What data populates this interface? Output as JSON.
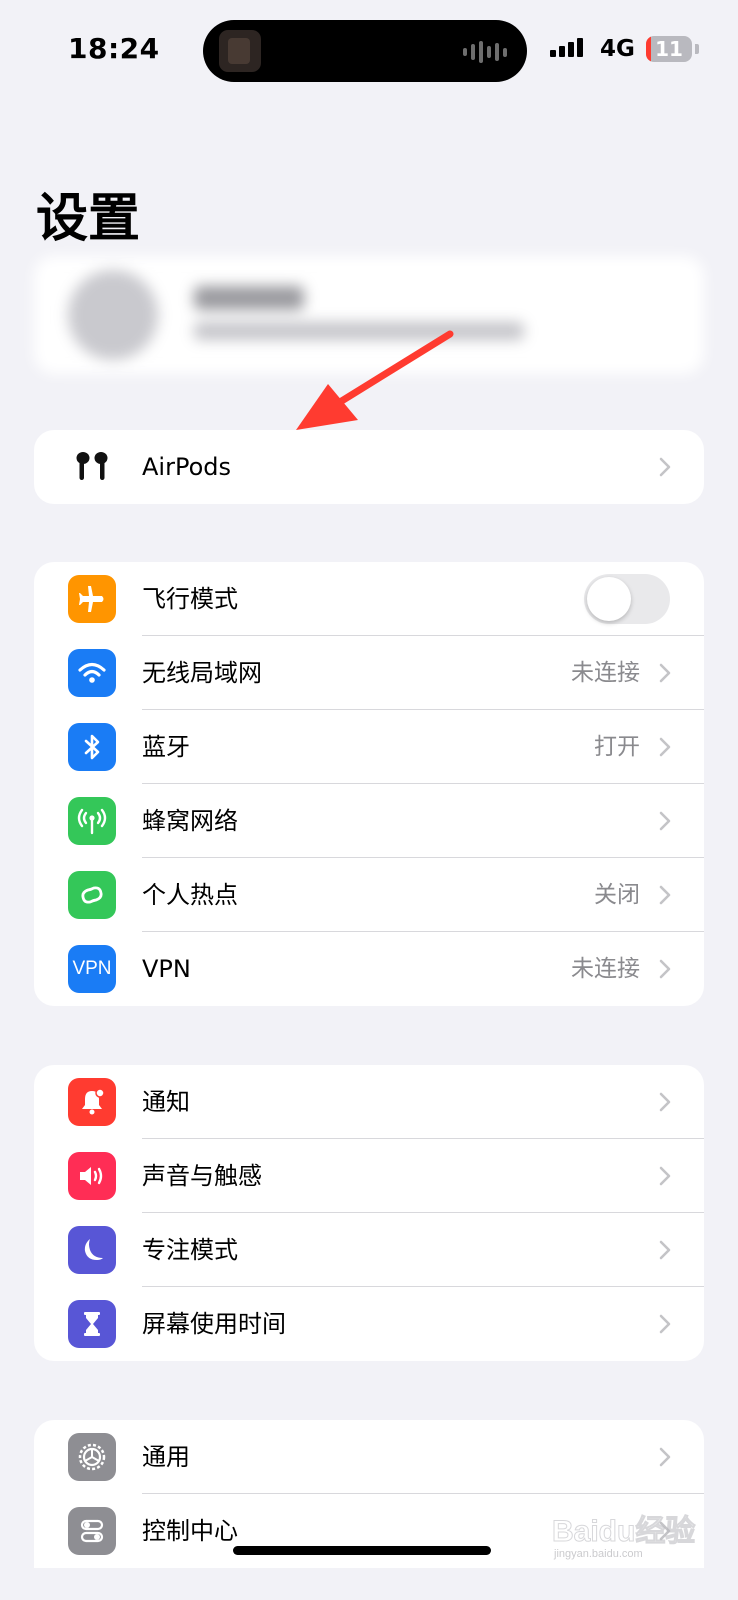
{
  "status_bar": {
    "time": "18:24",
    "network": "4G",
    "battery": "11"
  },
  "page": {
    "title": "设置"
  },
  "airpods_group": {
    "label": "AirPods"
  },
  "connectivity": [
    {
      "label": "飞行模式",
      "icon": "airplane-icon",
      "color": "#ff9500",
      "toggle": false
    },
    {
      "label": "无线局域网",
      "value": "未连接",
      "icon": "wifi-icon",
      "color": "#1a7cf5"
    },
    {
      "label": "蓝牙",
      "value": "打开",
      "icon": "bluetooth-icon",
      "color": "#1a7cf5"
    },
    {
      "label": "蜂窝网络",
      "icon": "cellular-antenna-icon",
      "color": "#34c759"
    },
    {
      "label": "个人热点",
      "value": "关闭",
      "icon": "hotspot-icon",
      "color": "#34c759"
    },
    {
      "label": "VPN",
      "value": "未连接",
      "icon": "vpn-icon",
      "icon_text": "VPN",
      "color": "#1a7cf5"
    }
  ],
  "notifications_group": [
    {
      "label": "通知",
      "icon": "notification-bell-icon",
      "color": "#ff3b30"
    },
    {
      "label": "声音与触感",
      "icon": "speaker-icon",
      "color": "#ff2d55"
    },
    {
      "label": "专注模式",
      "icon": "moon-icon",
      "color": "#5856d6"
    },
    {
      "label": "屏幕使用时间",
      "icon": "hourglass-icon",
      "color": "#5856d6"
    }
  ],
  "general_group": [
    {
      "label": "通用",
      "icon": "gear-icon",
      "color": "#8e8e93"
    },
    {
      "label": "控制中心",
      "icon": "control-center-icon",
      "color": "#8e8e93"
    }
  ],
  "watermark": {
    "brand": "Baidu经验",
    "url": "jingyan.baidu.com"
  },
  "annotation": {
    "arrow_color": "#ff3b30"
  }
}
